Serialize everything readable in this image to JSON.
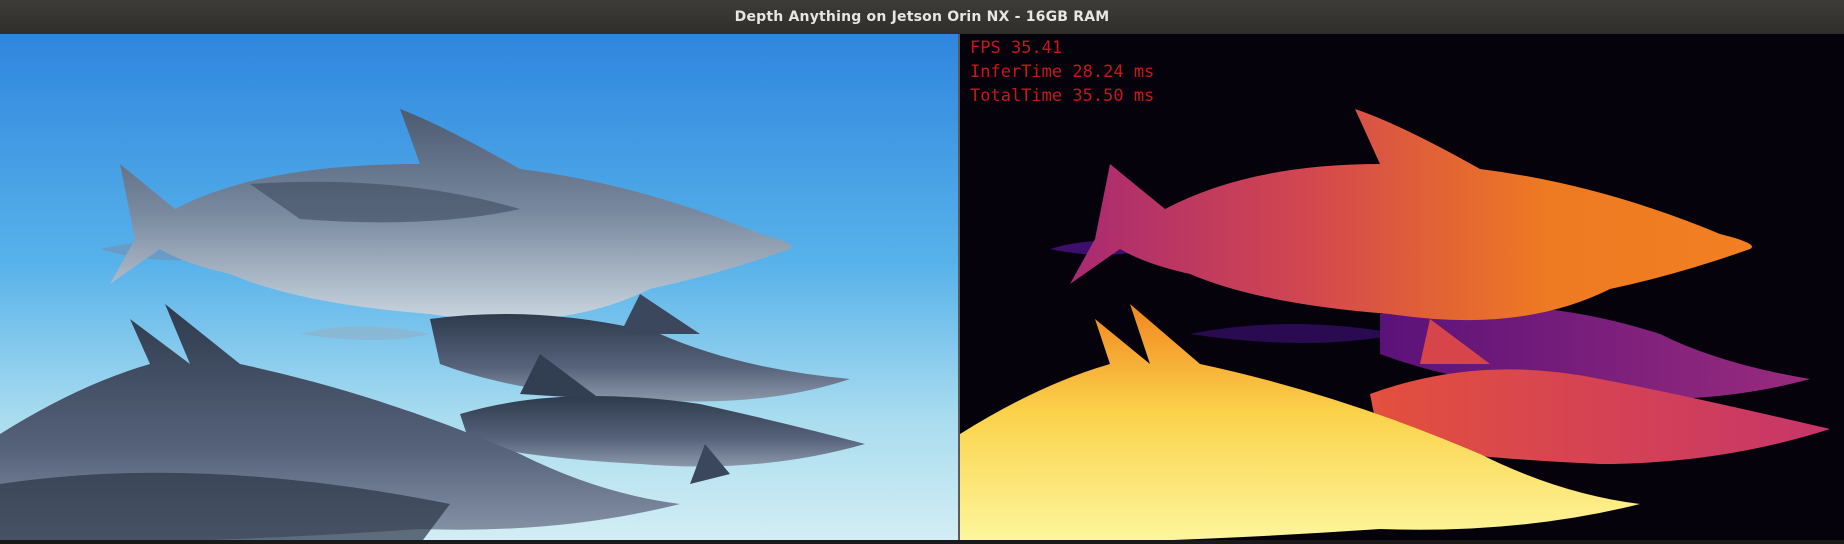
{
  "window": {
    "title": "Depth Anything on Jetson Orin NX - 16GB RAM"
  },
  "left_view": {
    "icon": "rgb-camera-frame",
    "colors": {
      "water_top": "#3a8ee0",
      "water_bottom": "#bfe7f3",
      "dolphin": "#5f6f85",
      "dolphin_belly": "#c7d3de"
    }
  },
  "right_view": {
    "icon": "depth-map-frame",
    "colors": {
      "background": "#06020c",
      "far": "#3a0d6b",
      "mid": "#b5317a",
      "near": "#f07a22",
      "nearest": "#fbf59a"
    }
  },
  "stats": {
    "fps_label": "FPS",
    "fps_value": "35.41",
    "infer_label": "InferTime",
    "infer_value": "28.24",
    "infer_unit": "ms",
    "total_label": "TotalTime",
    "total_value": "35.50",
    "total_unit": "ms",
    "text_color": "#c8161d"
  }
}
